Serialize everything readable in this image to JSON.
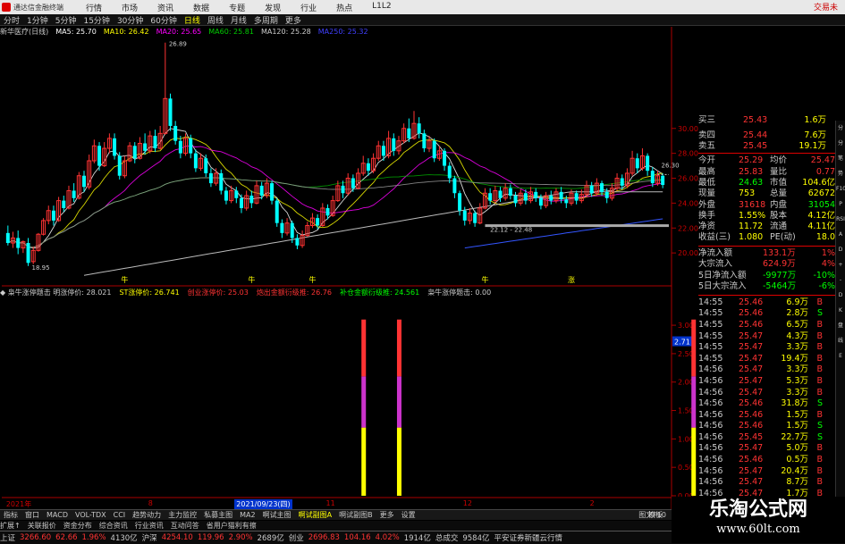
{
  "titlebar": {
    "app_name": "通达信金融终端",
    "menu": [
      "行情",
      "市场",
      "资讯",
      "数据",
      "专题",
      "发现",
      "行业",
      "热点",
      "L1L2"
    ],
    "right": "交易未"
  },
  "periods": [
    "分时",
    "1分钟",
    "5分钟",
    "15分钟",
    "30分钟",
    "60分钟",
    "日线",
    "周线",
    "月线",
    "多周期",
    "更多"
  ],
  "periods_active": "日线",
  "main_indicator": {
    "stock": "新华医疗(日线)",
    "items": [
      {
        "label": "MA5: 25.70",
        "color": "#ffffff"
      },
      {
        "label": "MA10: 26.42",
        "color": "#ffff00"
      },
      {
        "label": "MA20: 25.65",
        "color": "#ff00ff"
      },
      {
        "label": "MA60: 25.81",
        "color": "#00cc00"
      },
      {
        "label": "MA120: 25.28",
        "color": "#cccccc"
      },
      {
        "label": "MA250: 25.32",
        "color": "#4040ff"
      }
    ]
  },
  "sub_indicator": {
    "items": [
      {
        "label": "◆ 枭牛涨停题击  明涨停价: 28.021",
        "color": "#cccccc"
      },
      {
        "label": "ST涨停价: 26.741",
        "color": "#ffff00"
      },
      {
        "label": "创业涨停价: 25.03",
        "color": "#ff3333"
      },
      {
        "label": "炮出金额衍级推: 26.76",
        "color": "#ff3333"
      },
      {
        "label": "补仓金额衍级推: 24.561",
        "color": "#00ff00"
      },
      {
        "label": "枭牛涨停题击: 0.00",
        "color": "#cccccc"
      }
    ]
  },
  "chart_data": {
    "type": "candlestick",
    "price_axis": [
      "30.00",
      "28.00",
      "26.00",
      "24.00",
      "22.00",
      "20.00"
    ],
    "sub_axis": [
      "3.00",
      "2.50",
      "2.00",
      "1.50",
      "1.00",
      "0.50",
      "0.00"
    ],
    "annotations": {
      "high": "26.89",
      "low": "18.95",
      "range": "22.12 - 22.48",
      "ref": "26.30",
      "sub_value": "2.71"
    },
    "signal_markers": [
      "牛",
      "牛",
      "牛",
      "牛",
      "涨"
    ],
    "sub_signals": [
      {
        "index": 70,
        "segments": [
          {
            "color": "#ffff00",
            "from": 0,
            "to": 1.2
          },
          {
            "color": "#cc33cc",
            "from": 1.2,
            "to": 2.1
          },
          {
            "color": "#ff3333",
            "from": 2.1,
            "to": 3.1
          }
        ]
      },
      {
        "index": 77,
        "segments": [
          {
            "color": "#ffff00",
            "from": 0,
            "to": 1.2
          },
          {
            "color": "#cc33cc",
            "from": 1.2,
            "to": 2.1
          },
          {
            "color": "#ff3333",
            "from": 2.1,
            "to": 3.1
          }
        ]
      },
      {
        "index": 135,
        "segments": [
          {
            "color": "#ffff00",
            "from": 0,
            "to": 1.2
          },
          {
            "color": "#cc33cc",
            "from": 1.2,
            "to": 2.1
          },
          {
            "color": "#ff3333",
            "from": 2.1,
            "to": 3.1
          }
        ]
      }
    ],
    "dates": [
      {
        "label": "2021年",
        "i": 0
      },
      {
        "label": "8",
        "i": 28
      },
      {
        "label": "2021/09/23(四)",
        "i": 45
      },
      {
        "label": "11",
        "i": 63
      },
      {
        "label": "12",
        "i": 90
      },
      {
        "label": "2",
        "i": 115
      },
      {
        "label": "3",
        "i": 132
      }
    ],
    "candles": [
      [
        21.6,
        20.8,
        22.2,
        20.6
      ],
      [
        20.8,
        21.2,
        21.7,
        20.4
      ],
      [
        21.2,
        20.4,
        21.8,
        19.9
      ],
      [
        20.4,
        20.9,
        21.0,
        20.0
      ],
      [
        20.8,
        19.2,
        21.2,
        18.95
      ],
      [
        19.3,
        20.2,
        20.5,
        19.1
      ],
      [
        20.2,
        21.5,
        21.6,
        20.1
      ],
      [
        21.5,
        22.6,
        22.8,
        21.4
      ],
      [
        22.6,
        23.4,
        23.8,
        22.3
      ],
      [
        23.4,
        22.6,
        23.8,
        22.2
      ],
      [
        22.6,
        24.2,
        24.5,
        22.5
      ],
      [
        24.2,
        23.6,
        24.6,
        23.3
      ],
      [
        23.6,
        25.0,
        25.4,
        23.5
      ],
      [
        25.0,
        24.4,
        25.6,
        24.1
      ],
      [
        24.4,
        26.2,
        26.5,
        24.3
      ],
      [
        26.2,
        25.3,
        26.6,
        24.9
      ],
      [
        25.3,
        27.4,
        27.9,
        25.1
      ],
      [
        27.4,
        28.6,
        29.1,
        27.2
      ],
      [
        28.6,
        27.0,
        28.9,
        26.6
      ],
      [
        27.0,
        28.4,
        28.9,
        26.9
      ],
      [
        28.4,
        29.2,
        29.6,
        28.0
      ],
      [
        29.2,
        27.8,
        29.6,
        27.5
      ],
      [
        27.8,
        26.2,
        28.1,
        25.9
      ],
      [
        26.2,
        27.4,
        27.8,
        26.0
      ],
      [
        27.4,
        28.6,
        28.9,
        27.3
      ],
      [
        28.6,
        27.6,
        28.9,
        27.2
      ],
      [
        27.6,
        28.8,
        29.3,
        27.5
      ],
      [
        28.8,
        28.2,
        29.6,
        27.9
      ],
      [
        28.2,
        29.4,
        29.8,
        28.0
      ],
      [
        29.4,
        28.4,
        29.9,
        28.1
      ],
      [
        28.4,
        29.6,
        30.2,
        28.3
      ],
      [
        29.6,
        32.4,
        36.89,
        29.5
      ],
      [
        32.4,
        30.2,
        32.8,
        29.8
      ],
      [
        30.2,
        29.0,
        30.6,
        28.7
      ],
      [
        29.0,
        28.0,
        29.4,
        27.6
      ],
      [
        28.0,
        29.2,
        29.6,
        27.8
      ],
      [
        29.2,
        28.0,
        29.5,
        27.6
      ],
      [
        28.0,
        26.8,
        28.3,
        26.5
      ],
      [
        26.8,
        27.6,
        28.0,
        26.6
      ],
      [
        27.6,
        26.4,
        27.9,
        26.1
      ],
      [
        26.4,
        25.6,
        26.8,
        25.3
      ],
      [
        25.6,
        26.4,
        26.8,
        25.4
      ],
      [
        26.4,
        25.0,
        26.7,
        24.7
      ],
      [
        25.0,
        24.2,
        25.3,
        23.9
      ],
      [
        24.2,
        25.0,
        25.4,
        24.0
      ],
      [
        25.0,
        24.4,
        25.3,
        24.0
      ],
      [
        24.4,
        23.6,
        24.7,
        23.2
      ],
      [
        23.6,
        24.6,
        25.0,
        23.4
      ],
      [
        24.6,
        24.0,
        25.0,
        23.6
      ],
      [
        24.0,
        25.4,
        25.8,
        23.9
      ],
      [
        25.4,
        24.6,
        25.7,
        24.3
      ],
      [
        24.6,
        25.6,
        26.0,
        24.4
      ],
      [
        25.6,
        24.2,
        25.8,
        23.9
      ],
      [
        24.2,
        22.4,
        24.4,
        22.1
      ],
      [
        22.4,
        21.6,
        22.7,
        21.2
      ],
      [
        21.6,
        22.4,
        22.8,
        21.4
      ],
      [
        22.4,
        21.2,
        22.6,
        20.8
      ],
      [
        21.2,
        20.6,
        21.5,
        20.3
      ],
      [
        20.6,
        21.4,
        21.8,
        20.4
      ],
      [
        21.4,
        22.2,
        22.5,
        21.3
      ],
      [
        22.2,
        22.8,
        23.2,
        22.0
      ],
      [
        22.8,
        22.2,
        23.1,
        21.9
      ],
      [
        22.2,
        23.6,
        24.0,
        22.1
      ],
      [
        23.6,
        23.0,
        23.9,
        22.7
      ],
      [
        23.0,
        24.2,
        24.6,
        22.9
      ],
      [
        24.2,
        25.4,
        25.8,
        24.1
      ],
      [
        25.4,
        24.8,
        25.8,
        24.4
      ],
      [
        24.8,
        26.0,
        26.4,
        24.6
      ],
      [
        26.0,
        25.2,
        26.3,
        24.9
      ],
      [
        25.2,
        26.4,
        26.8,
        25.1
      ],
      [
        26.4,
        27.2,
        27.8,
        26.2
      ],
      [
        27.2,
        26.6,
        27.6,
        26.2
      ],
      [
        26.6,
        27.6,
        28.0,
        26.4
      ],
      [
        27.6,
        28.6,
        29.0,
        27.4
      ],
      [
        28.6,
        27.8,
        29.0,
        27.4
      ],
      [
        27.8,
        29.2,
        29.8,
        27.6
      ],
      [
        29.2,
        28.2,
        29.6,
        27.8
      ],
      [
        28.2,
        29.0,
        29.4,
        27.9
      ],
      [
        29.0,
        30.0,
        30.4,
        28.8
      ],
      [
        30.0,
        29.2,
        30.8,
        28.9
      ],
      [
        29.2,
        30.4,
        31.4,
        29.1
      ],
      [
        30.4,
        29.6,
        30.9,
        29.2
      ],
      [
        29.6,
        28.4,
        29.9,
        28.1
      ],
      [
        28.4,
        29.0,
        29.4,
        28.1
      ],
      [
        29.0,
        27.6,
        29.2,
        27.3
      ],
      [
        27.6,
        28.2,
        28.6,
        27.4
      ],
      [
        28.2,
        27.0,
        28.4,
        26.6
      ],
      [
        27.0,
        26.0,
        27.3,
        25.6
      ],
      [
        26.0,
        24.8,
        26.2,
        24.4
      ],
      [
        24.8,
        23.4,
        25.0,
        23.0
      ],
      [
        23.4,
        22.6,
        23.7,
        22.2
      ],
      [
        22.6,
        23.2,
        23.6,
        22.3
      ],
      [
        23.2,
        22.4,
        23.4,
        22.1
      ],
      [
        22.4,
        23.6,
        24.0,
        22.3
      ],
      [
        23.6,
        24.8,
        25.2,
        23.5
      ],
      [
        24.8,
        24.2,
        25.2,
        23.9
      ],
      [
        24.2,
        25.0,
        25.4,
        24.0
      ],
      [
        25.0,
        24.4,
        25.3,
        24.1
      ],
      [
        24.4,
        25.2,
        25.6,
        24.2
      ],
      [
        25.2,
        24.6,
        25.5,
        24.3
      ],
      [
        24.6,
        24.0,
        24.9,
        23.7
      ],
      [
        24.0,
        24.8,
        25.1,
        23.8
      ],
      [
        24.8,
        24.2,
        25.1,
        23.9
      ],
      [
        24.2,
        24.9,
        25.3,
        24.0
      ],
      [
        24.9,
        24.4,
        25.2,
        24.1
      ],
      [
        24.4,
        23.8,
        24.7,
        23.5
      ],
      [
        23.8,
        24.6,
        24.9,
        23.6
      ],
      [
        24.6,
        24.2,
        25.0,
        23.9
      ],
      [
        24.2,
        24.9,
        25.2,
        24.0
      ],
      [
        24.9,
        24.3,
        25.3,
        24.0
      ],
      [
        24.3,
        24.0,
        24.6,
        23.6
      ],
      [
        24.0,
        24.8,
        25.1,
        23.8
      ],
      [
        24.8,
        24.2,
        25.0,
        23.9
      ],
      [
        24.2,
        24.7,
        25.1,
        24.0
      ],
      [
        24.7,
        25.4,
        25.8,
        24.5
      ],
      [
        25.4,
        24.8,
        25.7,
        24.5
      ],
      [
        24.8,
        25.6,
        26.0,
        24.6
      ],
      [
        25.6,
        24.9,
        25.8,
        24.6
      ],
      [
        24.9,
        24.4,
        25.2,
        24.0
      ],
      [
        24.4,
        25.2,
        25.6,
        24.2
      ],
      [
        25.2,
        26.0,
        26.4,
        25.0
      ],
      [
        26.0,
        25.4,
        26.3,
        25.1
      ],
      [
        25.4,
        26.4,
        26.8,
        25.2
      ],
      [
        26.4,
        27.6,
        28.2,
        26.2
      ],
      [
        27.6,
        26.8,
        28.0,
        26.4
      ],
      [
        26.8,
        27.8,
        28.4,
        26.6
      ],
      [
        27.8,
        26.6,
        28.0,
        26.2
      ],
      [
        26.6,
        25.6,
        26.9,
        25.3
      ],
      [
        25.6,
        26.2,
        26.6,
        25.4
      ],
      [
        26.2,
        25.46,
        26.4,
        25.2
      ]
    ]
  },
  "quotes": [
    {
      "label": "卖四",
      "price": "25.44",
      "vol": "7.6万"
    },
    {
      "label": "卖五",
      "price": "25.45",
      "vol": "19.1万"
    }
  ],
  "quotes_top": {
    "label": "买三",
    "price": "25.43",
    "vol": "1.6万"
  },
  "stats": [
    {
      "l1": "今开",
      "v1": "25.29",
      "l2": "均价",
      "v2": "25.47",
      "c1": "#ff3333",
      "c2": "#ff3333"
    },
    {
      "l1": "最高",
      "v1": "25.83",
      "l2": "量比",
      "v2": "0.77",
      "c1": "#ff3333",
      "c2": "#ff3333"
    },
    {
      "l1": "最低",
      "v1": "24.63",
      "l2": "市值",
      "v2": "104.6亿",
      "c1": "#00ff00",
      "c2": "#ffff00"
    },
    {
      "l1": "现量",
      "v1": "753",
      "l2": "总量",
      "v2": "62672",
      "c1": "#ffff00",
      "c2": "#ffff00"
    },
    {
      "l1": "外盘",
      "v1": "31618",
      "l2": "内盘",
      "v2": "31054",
      "c1": "#ff3333",
      "c2": "#00ff00"
    },
    {
      "l1": "换手",
      "v1": "1.55%",
      "l2": "股本",
      "v2": "4.12亿",
      "c1": "#ffff00",
      "c2": "#ffff00"
    },
    {
      "l1": "净资",
      "v1": "11.72",
      "l2": "流通",
      "v2": "4.11亿",
      "c1": "#ffff00",
      "c2": "#ffff00"
    },
    {
      "l1": "收益(三)",
      "v1": "1.080",
      "l2": "PE(动)",
      "v2": "18.0",
      "c1": "#ffff00",
      "c2": "#ffff00"
    }
  ],
  "flows": [
    {
      "label": "净流入额",
      "val": "133.1万",
      "pct": "1%",
      "color": "#ff3333"
    },
    {
      "label": "大宗流入",
      "val": "624.9万",
      "pct": "4%",
      "color": "#ff3333"
    },
    {
      "label": "5日净流入额",
      "val": "-9977万",
      "pct": "-10%",
      "color": "#00ff00"
    },
    {
      "label": "5日大宗流入",
      "val": "-5464万",
      "pct": "-6%",
      "color": "#00ff00"
    }
  ],
  "ticks": [
    {
      "t": "14:55",
      "p": "25.46",
      "v": "6.9万",
      "s": "B"
    },
    {
      "t": "14:55",
      "p": "25.46",
      "v": "2.8万",
      "s": "S"
    },
    {
      "t": "14:55",
      "p": "25.46",
      "v": "6.5万",
      "s": "B"
    },
    {
      "t": "14:55",
      "p": "25.47",
      "v": "4.3万",
      "s": "B"
    },
    {
      "t": "14:55",
      "p": "25.47",
      "v": "3.3万",
      "s": "B"
    },
    {
      "t": "14:55",
      "p": "25.47",
      "v": "19.4万",
      "s": "B"
    },
    {
      "t": "14:56",
      "p": "25.47",
      "v": "3.3万",
      "s": "B"
    },
    {
      "t": "14:56",
      "p": "25.47",
      "v": "5.3万",
      "s": "B"
    },
    {
      "t": "14:56",
      "p": "25.47",
      "v": "3.3万",
      "s": "B"
    },
    {
      "t": "14:56",
      "p": "25.46",
      "v": "31.8万",
      "s": "S"
    },
    {
      "t": "14:56",
      "p": "25.46",
      "v": "1.5万",
      "s": "B"
    },
    {
      "t": "14:56",
      "p": "25.46",
      "v": "1.5万",
      "s": "S"
    },
    {
      "t": "14:56",
      "p": "25.45",
      "v": "22.7万",
      "s": "S"
    },
    {
      "t": "14:56",
      "p": "25.47",
      "v": "5.0万",
      "s": "B"
    },
    {
      "t": "14:56",
      "p": "25.46",
      "v": "0.5万",
      "s": "B"
    },
    {
      "t": "14:56",
      "p": "25.47",
      "v": "20.4万",
      "s": "B"
    },
    {
      "t": "14:56",
      "p": "25.47",
      "v": "8.7万",
      "s": "B"
    },
    {
      "t": "14:56",
      "p": "25.47",
      "v": "1.7万",
      "s": "B"
    },
    {
      "t": "14:56",
      "p": "25.47",
      "v": "4.1万",
      "s": "B"
    },
    {
      "t": "14:56",
      "p": "25.47",
      "v": "1.5万",
      "s": "B"
    }
  ],
  "sidebar": [
    "分时",
    "分笔",
    "笔",
    "势",
    "F10",
    "P",
    "RSI",
    "A",
    "D",
    "+",
    "-",
    "D",
    "K",
    "盘",
    "线",
    "E"
  ],
  "tabs": [
    "指标",
    "窗口",
    "MACD",
    "VOL-TDX",
    "CCI",
    "趋势动力",
    "主力监控",
    "私募主图",
    "MA2",
    "啊试主图",
    "啊试副图A",
    "啊试副图B",
    "更多",
    "设置"
  ],
  "tabs_active": "啊试副图A",
  "mode": "模板",
  "tab_right": "图文F10",
  "status": [
    {
      "t": "上证",
      "c": "#ccc"
    },
    {
      "t": "3266.60",
      "c": "#ff3333"
    },
    {
      "t": "62.66",
      "c": "#ff3333"
    },
    {
      "t": "1.96%",
      "c": "#ff3333"
    },
    {
      "t": "4130亿",
      "c": "#ccc"
    },
    {
      "t": "沪深",
      "c": "#ccc"
    },
    {
      "t": "4254.10",
      "c": "#ff3333"
    },
    {
      "t": "119.96",
      "c": "#ff3333"
    },
    {
      "t": "2.90%",
      "c": "#ff3333"
    },
    {
      "t": "2689亿",
      "c": "#ccc"
    },
    {
      "t": "创业",
      "c": "#ccc"
    },
    {
      "t": "2696.83",
      "c": "#ff3333"
    },
    {
      "t": "104.16",
      "c": "#ff3333"
    },
    {
      "t": "4.02%",
      "c": "#ff3333"
    },
    {
      "t": "1914亿",
      "c": "#ccc"
    },
    {
      "t": "总成交",
      "c": "#ccc"
    },
    {
      "t": "9584亿",
      "c": "#ccc"
    },
    {
      "t": "平安证券新疆云行情",
      "c": "#ccc"
    }
  ],
  "status2": [
    "扩展↑",
    "关联报价",
    "资金分布",
    "综合资讯",
    "行业资讯",
    "互动问答",
    "省用户猫利有擦"
  ],
  "watermark": {
    "title": "乐淘公式网",
    "url": "www.60lt.com"
  }
}
